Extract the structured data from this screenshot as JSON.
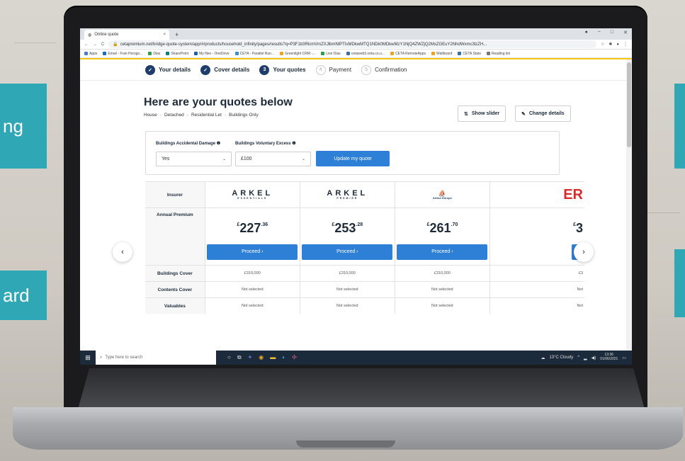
{
  "backdrop": {
    "left_tile_1": "ng",
    "left_tile_2": "ard"
  },
  "browser": {
    "tab_title": "Online quote",
    "tab_close": "×",
    "new_tab": "+",
    "window_controls": [
      "−",
      "□",
      "✕"
    ],
    "nav": {
      "back": "←",
      "forward": "→",
      "reload": "C"
    },
    "url": "cetapremium.net/bridge-quote-system/app/#/products/household_infinity/pages/results?q=P3F1b3RlcmVmZXJlbmNlPTIxMDkwMTQ1NDk0MDkwMzY1NjQ4ZWZjQ2MxZGEuY2NhdWxmc3lzZH...",
    "bookmarks": [
      {
        "label": "Apps",
        "color": "#4a7bd1"
      },
      {
        "label": "Email - Fran Horsgo...",
        "color": "#1a6bc7"
      },
      {
        "label": "Dias",
        "color": "#2e9e4a"
      },
      {
        "label": "SharePoint",
        "color": "#0a7d87"
      },
      {
        "label": "My files - OneDrive",
        "color": "#1c5fb0"
      },
      {
        "label": "CETA - Parallel Run...",
        "color": "#3b8fd8"
      },
      {
        "label": "Greenlight CRM -...",
        "color": "#e9a325"
      },
      {
        "label": "Live Dias",
        "color": "#2e9e4a"
      },
      {
        "label": "cetaweb3.ceta.co.u...",
        "color": "#3a6ea5"
      },
      {
        "label": "CETA RemoteApps",
        "color": "#e9a325"
      },
      {
        "label": "Wallboard",
        "color": "#e9a325"
      },
      {
        "label": "CETA Stats",
        "color": "#3a6ea5"
      },
      {
        "label": "Reading list",
        "color": "#777777"
      }
    ]
  },
  "steps": [
    {
      "num": "✓",
      "label": "Your details",
      "state": "done"
    },
    {
      "num": "✓",
      "label": "Cover details",
      "state": "done"
    },
    {
      "num": "3",
      "label": "Your quotes",
      "state": "current"
    },
    {
      "num": "4",
      "label": "Payment",
      "state": "pending"
    },
    {
      "num": "5",
      "label": "Confirmation",
      "state": "pending"
    }
  ],
  "page": {
    "title": "Here are your quotes below",
    "subtitle": [
      "House",
      "Detached",
      "Residential Let",
      "Buildings Only"
    ],
    "subtitle_sep": "·",
    "show_slider": "Show slider",
    "change_details": "Change details"
  },
  "filters": {
    "accidental_label": "Buildings Accidental Damage ❶",
    "accidental_value": "Yes",
    "excess_label": "Buildings Voluntary Excess ❶",
    "excess_value": "£100",
    "update_button": "Update my quote"
  },
  "table": {
    "labels": {
      "insurer": "Insurer",
      "annual_premium": "Annual Premium",
      "buildings_cover": "Buildings Cover",
      "contents_cover": "Contents Cover",
      "valuables": "Valuables"
    },
    "insurers": [
      {
        "logo_main": "ARKEL",
        "logo_sub": "ESSENTIALS",
        "currency": "£",
        "price_whole": "227",
        "price_pence": ".36",
        "proceed": "Proceed  ›",
        "buildings_cover": "£310,000",
        "contents_cover": "Not selected",
        "valuables": "Not selected"
      },
      {
        "logo_main": "ARKEL",
        "logo_sub": "PREMIER",
        "currency": "£",
        "price_whole": "253",
        "price_pence": ".28",
        "proceed": "Proceed  ›",
        "buildings_cover": "£310,000",
        "contents_cover": "Not selected",
        "valuables": "Not selected"
      },
      {
        "logo_main": "Arthur Europe",
        "logo_sub": "",
        "currency": "£",
        "price_whole": "261",
        "price_pence": ".70",
        "proceed": "Proceed  ›",
        "buildings_cover": "£310,000",
        "contents_cover": "Not selected",
        "valuables": "Not selected"
      },
      {
        "logo_main": "ER",
        "logo_sub": "",
        "currency": "£",
        "price_whole": "3",
        "price_pence": "",
        "proceed": "Pro",
        "buildings_cover": "£3",
        "contents_cover": "Not",
        "valuables": "Not"
      }
    ],
    "prev_arrow": "‹",
    "next_arrow": "›"
  },
  "taskbar": {
    "search_placeholder": "Type here to search",
    "weather": "13°C Cloudy",
    "time": "13:36",
    "date": "01/06/2021"
  }
}
